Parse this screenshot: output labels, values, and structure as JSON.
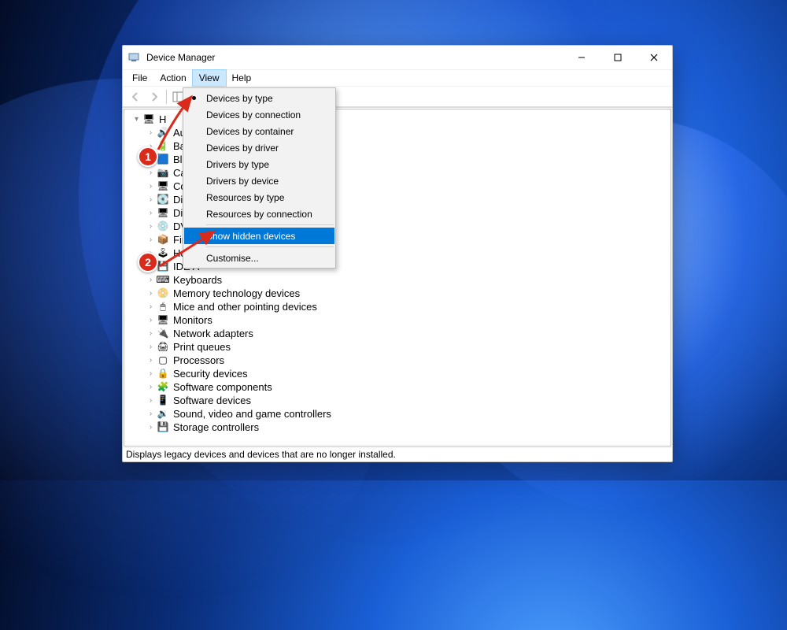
{
  "window": {
    "title": "Device Manager"
  },
  "menu": {
    "items": [
      "File",
      "Action",
      "View",
      "Help"
    ],
    "active_index": 2
  },
  "dropdown": {
    "items": [
      {
        "label": "Devices by type",
        "checked": true
      },
      {
        "label": "Devices by connection"
      },
      {
        "label": "Devices by container"
      },
      {
        "label": "Devices by driver"
      },
      {
        "label": "Drivers by type"
      },
      {
        "label": "Drivers by device"
      },
      {
        "label": "Resources by type"
      },
      {
        "label": "Resources by connection"
      }
    ],
    "highlighted": {
      "label": "Show hidden devices"
    },
    "footer": {
      "label": "Customise..."
    }
  },
  "tree": {
    "root_prefix": "H",
    "nodes": [
      {
        "label": "Aud",
        "icon": "🔊"
      },
      {
        "label": "Batt",
        "icon": "🔋"
      },
      {
        "label": "Blue",
        "icon": "🟦"
      },
      {
        "label": "Cam",
        "icon": "📷"
      },
      {
        "label": "Con",
        "icon": "🖥"
      },
      {
        "label": "Disk",
        "icon": "💽"
      },
      {
        "label": "Disp",
        "icon": "🖥"
      },
      {
        "label": "DVD",
        "icon": "💿"
      },
      {
        "label": "Firm",
        "icon": "📦"
      },
      {
        "label": "Hun",
        "icon": "🕹"
      },
      {
        "label": "IDE ATA/ATAPI controllers",
        "icon": "💾",
        "partial": "IDE A"
      },
      {
        "label": "Keyboards",
        "icon": "⌨"
      },
      {
        "label": "Memory technology devices",
        "icon": "📀"
      },
      {
        "label": "Mice and other pointing devices",
        "icon": "🖱"
      },
      {
        "label": "Monitors",
        "icon": "🖥"
      },
      {
        "label": "Network adapters",
        "icon": "🔌"
      },
      {
        "label": "Print queues",
        "icon": "🖨"
      },
      {
        "label": "Processors",
        "icon": "▢"
      },
      {
        "label": "Security devices",
        "icon": "🔒"
      },
      {
        "label": "Software components",
        "icon": "🧩"
      },
      {
        "label": "Software devices",
        "icon": "📱"
      },
      {
        "label": "Sound, video and game controllers",
        "icon": "🔉"
      },
      {
        "label": "Storage controllers",
        "icon": "💾"
      }
    ]
  },
  "status": "Displays legacy devices and devices that are no longer installed.",
  "annotations": {
    "badge1": "1",
    "badge2": "2"
  }
}
